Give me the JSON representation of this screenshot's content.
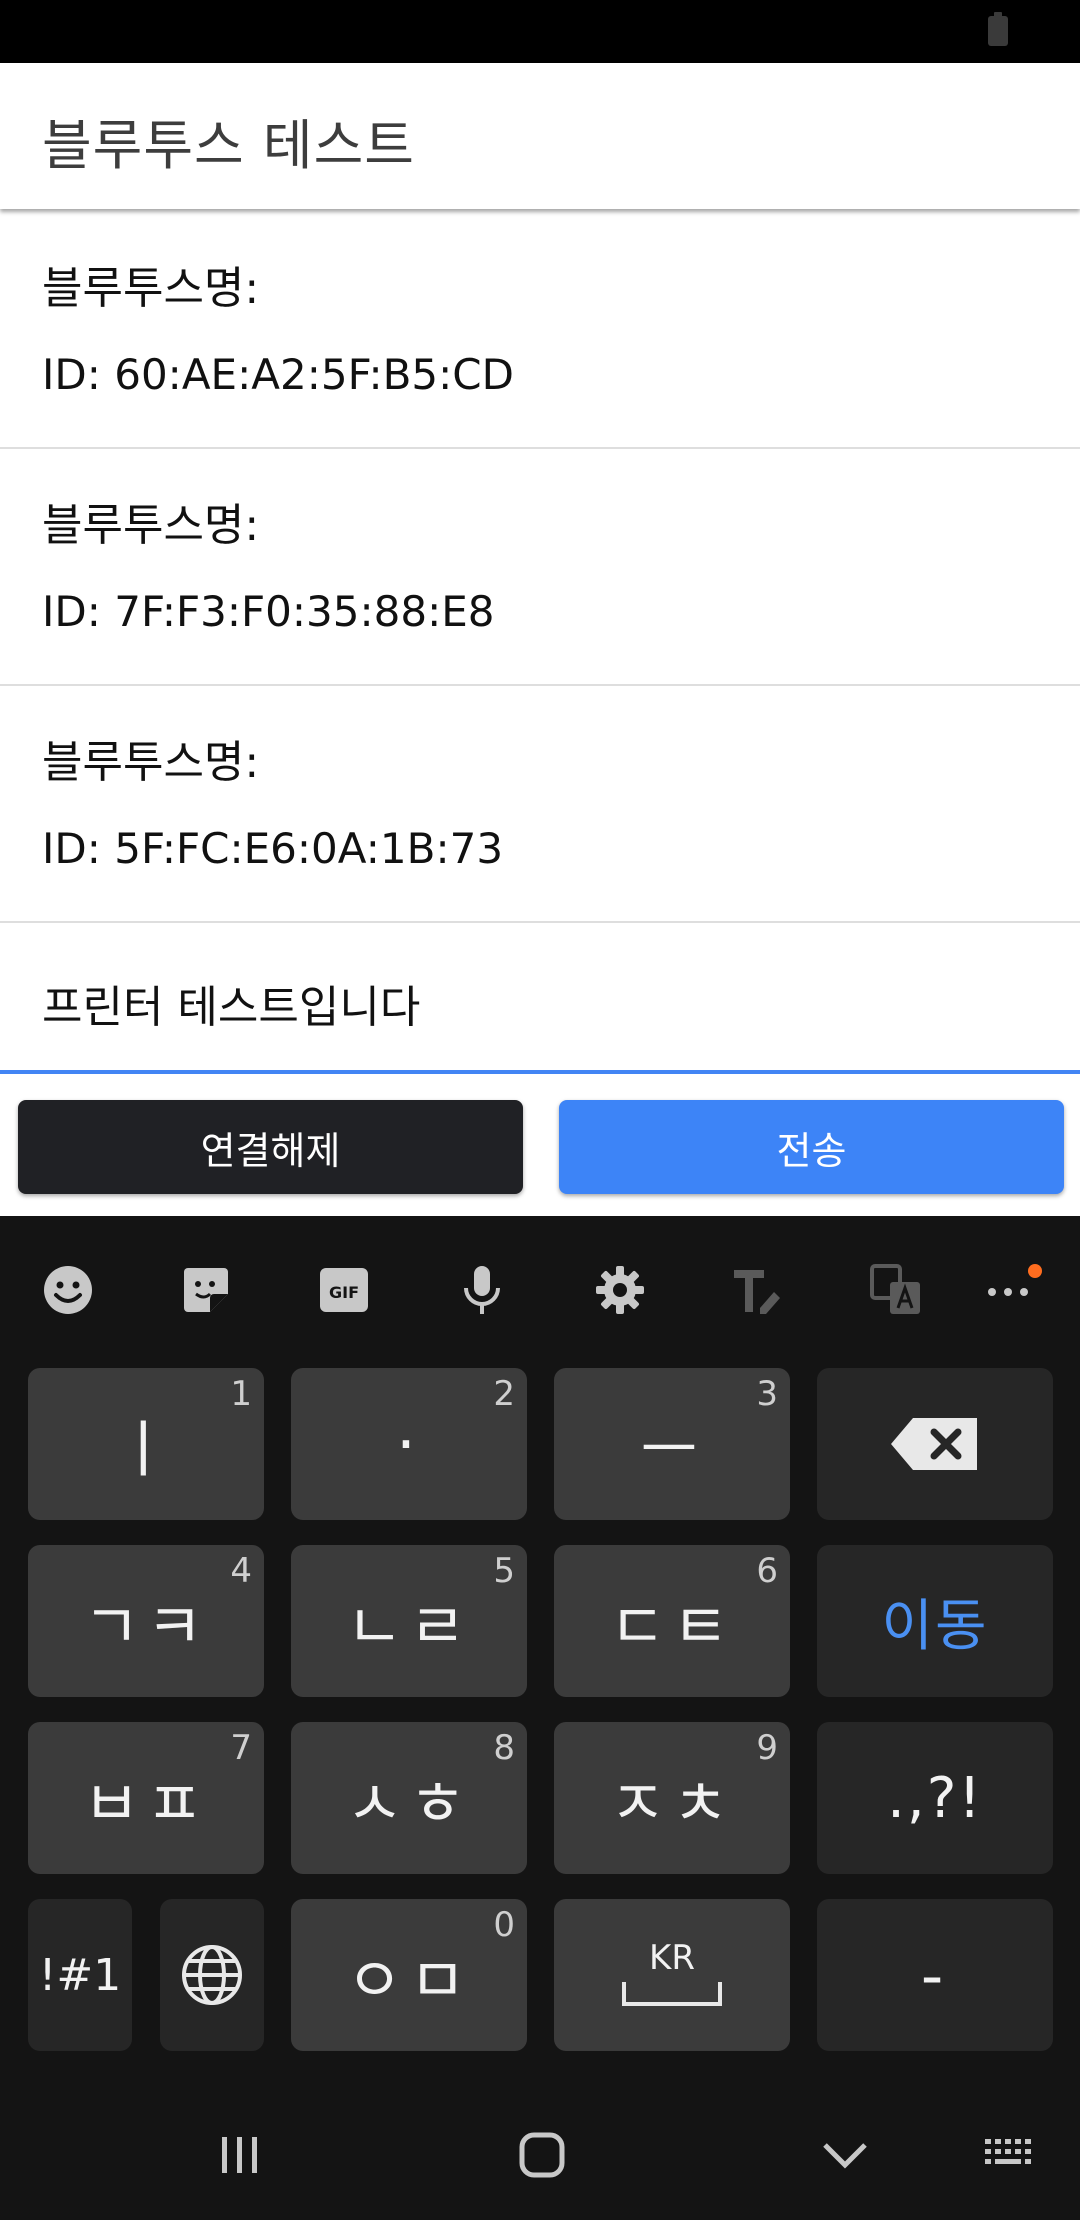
{
  "app": {
    "title": "블루투스 테스트"
  },
  "devices": [
    {
      "name_label": "블루투스명:",
      "id_label": "ID: 60:AE:A2:5F:B5:CD"
    },
    {
      "name_label": "블루투스명:",
      "id_label": "ID: 7F:F3:F0:35:88:E8"
    },
    {
      "name_label": "블루투스명:",
      "id_label": "ID: 5F:FC:E6:0A:1B:73"
    }
  ],
  "message": {
    "value": "프린터 테스트입니다"
  },
  "buttons": {
    "disconnect": "연결해제",
    "send": "전송"
  },
  "keyboard": {
    "toolbar": [
      "emoji-icon",
      "sticker-icon",
      "gif-icon",
      "microphone-icon",
      "settings-icon",
      "text-edit-icon",
      "translate-icon",
      "more-icon"
    ],
    "gif_label": "GIF",
    "keys": [
      {
        "label": "ㅣ",
        "num": "1"
      },
      {
        "label": "·",
        "num": "2"
      },
      {
        "label": "ㅡ",
        "num": "3"
      },
      {
        "label": "ㄱㅋ",
        "num": "4"
      },
      {
        "label": "ㄴㄹ",
        "num": "5"
      },
      {
        "label": "ㄷㅌ",
        "num": "6"
      },
      {
        "label": "이동"
      },
      {
        "label": "ㅂㅍ",
        "num": "7"
      },
      {
        "label": "ㅅㅎ",
        "num": "8"
      },
      {
        "label": "ㅈㅊ",
        "num": "9"
      },
      {
        "label": ".,?!"
      },
      {
        "label": "!#1"
      },
      {
        "label": "ㅇㅁ",
        "num": "0"
      },
      {
        "label": "KR"
      },
      {
        "label": "-"
      }
    ]
  },
  "colors": {
    "accent": "#3d84f7",
    "dark_button": "#202125",
    "keyboard_bg": "#141414",
    "key_bg": "#3b3b3b",
    "badge": "#ff6d1f"
  }
}
